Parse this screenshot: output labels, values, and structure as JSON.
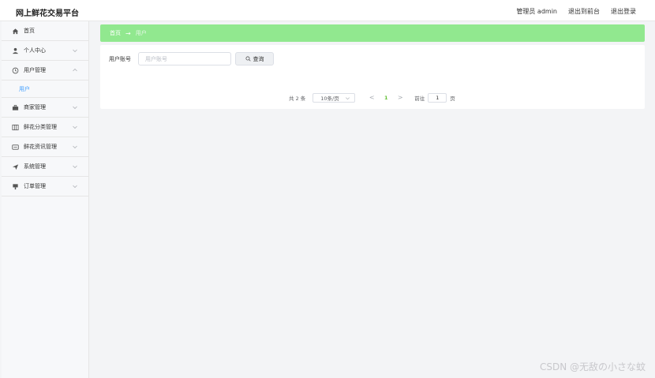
{
  "header": {
    "brand": "网上鲜花交易平台",
    "role_user": "管理员 admin",
    "front_link": "退出到前台",
    "logout_link": "退出登录"
  },
  "sidebar": {
    "items": [
      {
        "label": "首页",
        "icon": "home-icon"
      },
      {
        "label": "个人中心",
        "icon": "user-icon"
      },
      {
        "label": "用户管理",
        "icon": "clock-icon"
      },
      {
        "label": "商家管理",
        "icon": "shop-icon"
      },
      {
        "label": "鲜花分类管理",
        "icon": "grid-icon"
      },
      {
        "label": "鲜花资讯管理",
        "icon": "card-icon"
      },
      {
        "label": "系统管理",
        "icon": "send-icon"
      },
      {
        "label": "订单管理",
        "icon": "goods-icon"
      }
    ],
    "subitem": "用户"
  },
  "breadcrumb": {
    "home": "首页",
    "separator": "→",
    "current": "用户"
  },
  "search": {
    "label": "用户账号",
    "placeholder": "用户账号",
    "button": "查询"
  },
  "pagination": {
    "total": "共 2 条",
    "page_size": "10条/页",
    "prev": "<",
    "current_page": "1",
    "next": ">",
    "goto_label": "前往",
    "goto_value": "1",
    "goto_unit": "页"
  },
  "watermark": "CSDN @无敌の小さな蚊",
  "colors": {
    "accent_green": "#91e88f",
    "page_active": "#67c23a",
    "submenu_active": "#409eff"
  }
}
